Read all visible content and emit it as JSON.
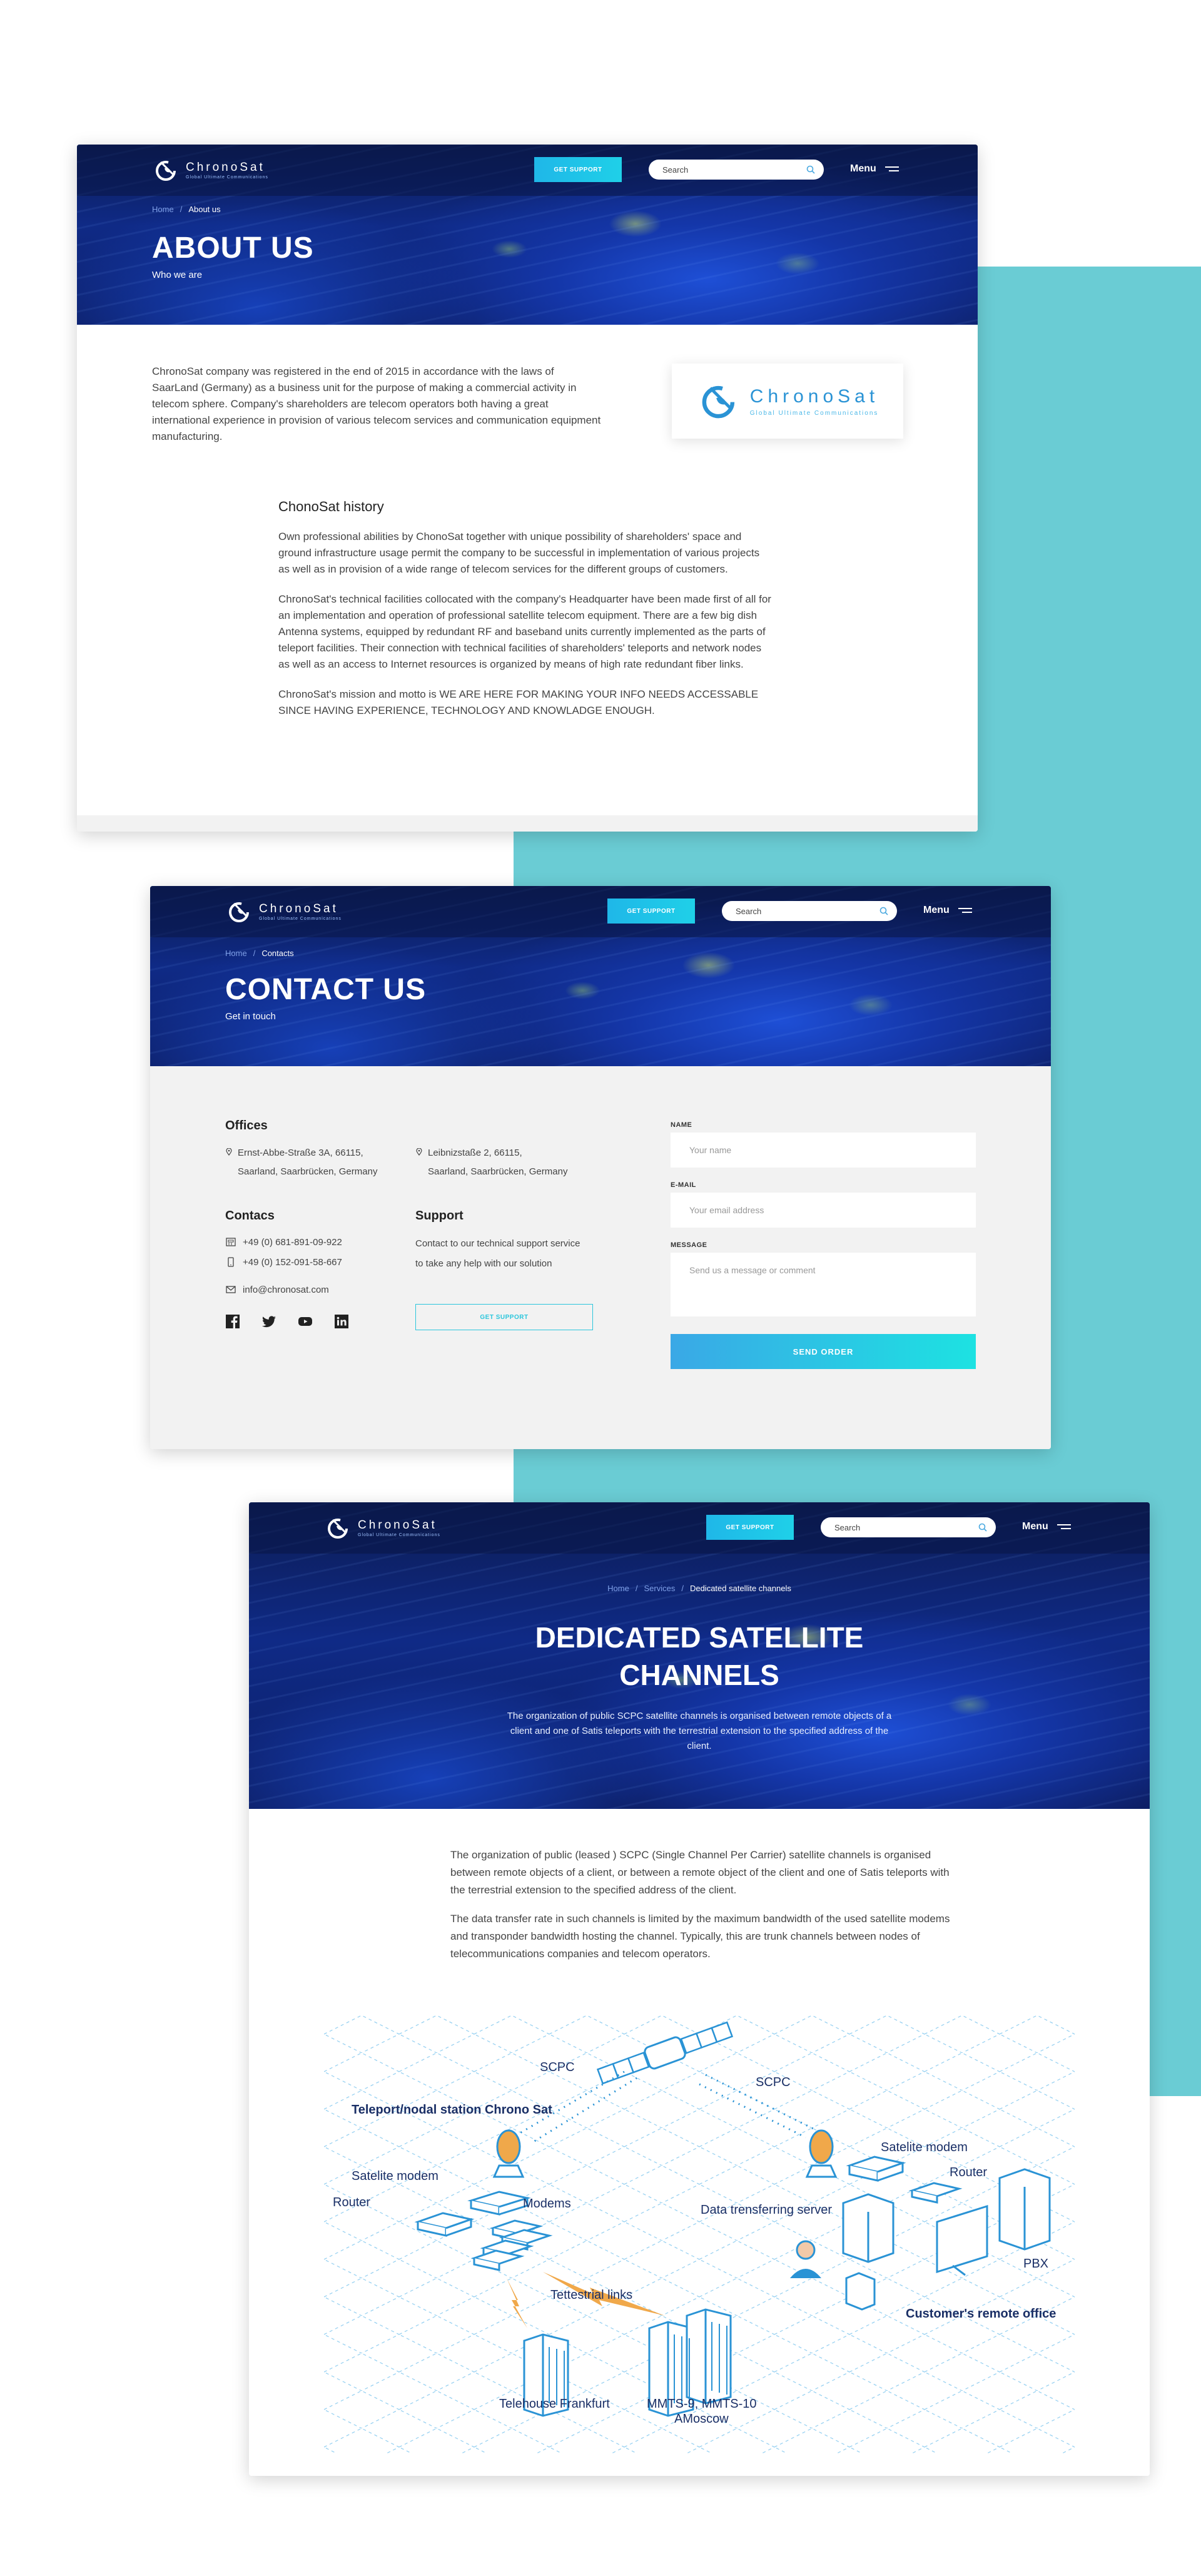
{
  "nav": {
    "logo_name": "ChronoSat",
    "logo_tagline": "Global Ultimate Communications",
    "support_label": "GET SUPPORT",
    "search_placeholder": "Search",
    "menu_label": "Menu"
  },
  "about": {
    "breadcrumb": [
      "Home",
      "/",
      "About us"
    ],
    "title": "ABOUT US",
    "subtitle": "Who we are",
    "intro": "ChronoSat company was registered in the end of 2015 in accordance with the laws of SaarLand (Germany) as a business unit for the purpose of making a commercial activity in telecom sphere. Company's shareholders are telecom operators both having a great international experience in provision of various telecom services and communication equipment manufacturing.",
    "logo_name": "ChronoSat",
    "logo_tagline": "Global Ultimate Communications",
    "history_title": "ChonoSat history",
    "history": [
      "Own professional abilities by ChonoSat together with unique possibility of shareholders' space and ground infrastructure usage permit the company to be successful in implementation of various projects as well as in provision of a wide range of telecom services for the different groups of customers.",
      "ChronoSat's technical facilities collocated with the company's Headquarter have been made first of all for an implementation and operation of professional satellite telecom equipment. There are a few big dish Antenna systems, equipped by redundant RF and baseband units currently implemented as the parts of teleport facilities. Their connection with technical facilities of shareholders' teleports and network nodes as well as an access to Internet resources is organized by means of high rate redundant fiber links.",
      "ChronoSat's mission and motto is WE ARE HERE FOR MAKING YOUR INFO NEEDS ACCESSABLE SINCE HAVING EXPERIENCE, TECHNOLOGY AND KNOWLADGE ENOUGH."
    ]
  },
  "contact": {
    "breadcrumb": [
      "Home",
      "/",
      "Contacts"
    ],
    "title": "CONTACT US",
    "subtitle": "Get in touch",
    "offices_title": "Offices",
    "office1": [
      "Ernst-Abbe-Straße 3A, 66115,",
      "Saarland, Saarbrücken, Germany"
    ],
    "office2": [
      "Leibnizstaße 2, 66115,",
      "Saarland, Saarbrücken, Germany"
    ],
    "contacts_title": "Contacs",
    "phone1": "+49 (0) 681-891-09-922",
    "phone2": "+49 (0) 152-091-58-667",
    "email": "info@chronosat.com",
    "support_title": "Support",
    "support_text": "Contact to our technical support service to take any help with our solution",
    "support_button": "GET SUPPORT",
    "form": {
      "name_label": "NAME",
      "name_placeholder": "Your name",
      "email_label": "E-MAIL",
      "email_placeholder": "Your email address",
      "message_label": "MESSAGE",
      "message_placeholder": "Send us a message or comment",
      "send_label": "SEND ORDER"
    }
  },
  "dedicated": {
    "breadcrumb": [
      "Home",
      "/",
      "Services",
      "/",
      "Dedicated satellite channels"
    ],
    "title_line1": "DEDICATED SATELLITE",
    "title_line2": "CHANNELS",
    "subtitle": "The organization of public SCPC satellite channels is organised between remote objects of a client and one of Satis teleports with the terrestrial extension to the specified address of the client.",
    "p1": "The organization of public (leased ) SCPC (Single Channel Per Carrier) satellite channels is organised between remote objects of a client, or between a remote object of the client and one of Satis teleports with the terrestrial extension to the specified address of the client.",
    "p2": "The data transfer rate in such channels is limited by the maximum bandwidth of the used satellite modems and transponder bandwidth hosting the channel. Typically, this are trunk channels between nodes of telecommunications companies and telecom operators.",
    "diagram": {
      "scpc_left": "SCPC",
      "scpc_right": "SCPC",
      "teleport": "Teleport/nodal station Chrono Sat",
      "sat_modem_left": "Satelite modem",
      "router_left": "Router",
      "modems": "Modems",
      "terrestrial": "Tettestrial links",
      "frankfurt": "Telehouse Frankfurt",
      "mmts1": "MMTS-9, MMTS-10",
      "mmts2": "AMoscow",
      "sat_modem_right": "Satelite modem",
      "router_right": "Router",
      "data_server": "Data trensferring server",
      "pbx": "PBX",
      "remote_office": "Customer's remote office"
    }
  },
  "colors": {
    "teal_band": "#6accd4",
    "accent": "#1fc6e8",
    "navy": "#0f2a86",
    "diagram_blue": "#2a93d5"
  }
}
